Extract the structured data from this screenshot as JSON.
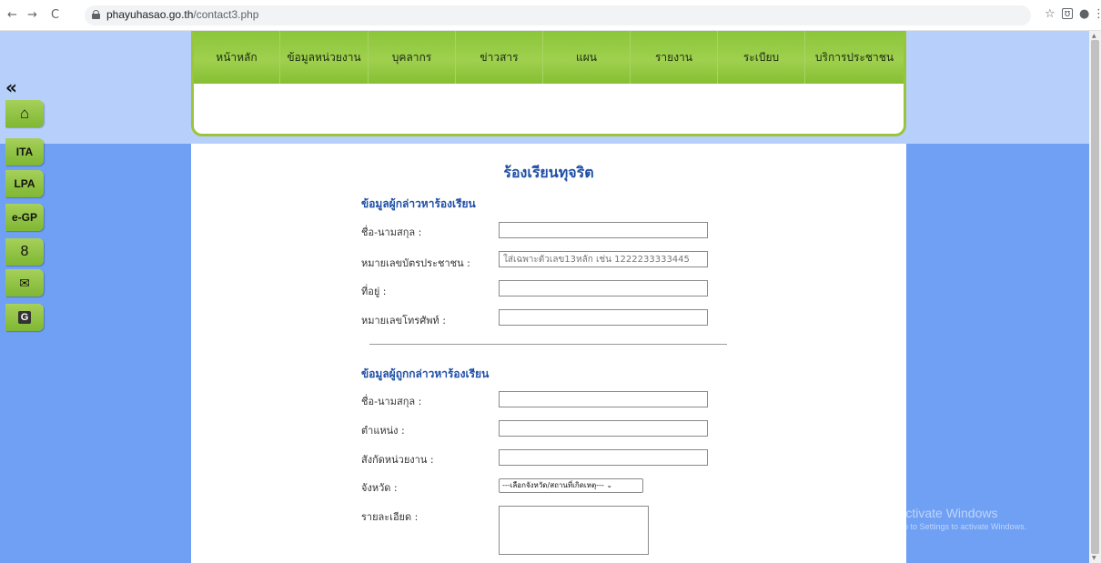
{
  "browser": {
    "url_domain": "phayuhasao.go.th",
    "url_path": "/contact3.php",
    "back": "←",
    "forward": "→",
    "reload": "C",
    "star": "☆",
    "ext": "ʊ",
    "profile": "●",
    "menu": "⋮"
  },
  "nav": {
    "items": [
      "หน้าหลัก",
      "ข้อมูลหน่วยงาน",
      "บุคลากร",
      "ข่าวสาร",
      "แผน",
      "รายงาน",
      "ระเบียบ",
      "บริการประชาชน"
    ]
  },
  "sidebar": {
    "collapse": "«",
    "home": "⌂",
    "ita": "ITA",
    "lpa": "LPA",
    "egp": "e-GP",
    "person": "8",
    "mail": "✉",
    "translate": "G"
  },
  "form": {
    "title": "ร้องเรียนทุจริต",
    "complainant_title": "ข้อมูลผู้กล่าวหาร้องเรียน",
    "accused_title": "ข้อมูลผู้ถูกกล่าวหาร้องเรียน",
    "labels": {
      "name": "ชื่อ-นามสกุล :",
      "id_card": "หมายเลขบัตรประชาชน :",
      "address": "ที่อยู่ :",
      "phone": "หมายเลขโทรศัพท์ :",
      "accused_name": "ชื่อ-นามสกุล :",
      "position": "ตำแหน่ง :",
      "agency": "สังกัดหน่วยงาน :",
      "province": "จังหวัด :",
      "detail": "รายละเอียด :"
    },
    "placeholders": {
      "id_card": "ใส่เฉพาะตัวเลข13หลัก เช่น 1222233333445"
    },
    "province_select": "---เลือกจังหวัด/สถานที่เกิดเหตุ---"
  },
  "watermark": {
    "title": "Activate Windows",
    "sub": "Go to Settings to activate Windows."
  }
}
